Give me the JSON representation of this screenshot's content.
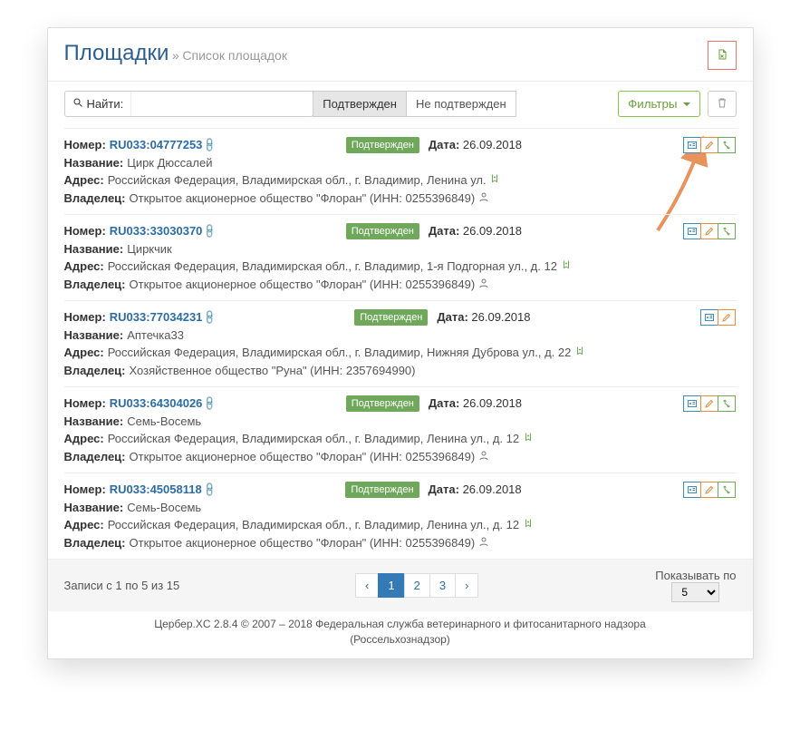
{
  "header": {
    "title": "Площадки",
    "sep": "»",
    "subtitle": "Список площадок"
  },
  "toolbar": {
    "find_label": "Найти:",
    "search_value": "",
    "search_placeholder": "",
    "tab_confirmed": "Подтвержден",
    "tab_unconfirmed": "Не подтвержден",
    "filters_label": "Фильтры"
  },
  "labels": {
    "number": "Номер:",
    "name": "Название:",
    "address": "Адрес:",
    "owner": "Владелец:",
    "date": "Дата:",
    "inn_prefix": "(ИНН:",
    "inn_suffix": ")"
  },
  "badge_confirmed": "Подтвержден",
  "items": [
    {
      "id": "RU033:04777253",
      "date": "26.09.2018",
      "name": "Цирк Дюссалей",
      "address": "Российская Федерация, Владимирская обл., г. Владимир, Ленина ул.",
      "owner": "Открытое акционерное общество \"Флоран\"",
      "inn": "0255396849",
      "show_user_icon": true,
      "actions": [
        "card",
        "edit",
        "branch"
      ]
    },
    {
      "id": "RU033:33030370",
      "date": "26.09.2018",
      "name": "Циркчик",
      "address": "Российская Федерация, Владимирская обл., г. Владимир, 1-я Подгорная ул., д. 12",
      "owner": "Открытое акционерное общество \"Флоран\"",
      "inn": "0255396849",
      "show_user_icon": true,
      "actions": [
        "card",
        "edit",
        "branch"
      ]
    },
    {
      "id": "RU033:77034231",
      "date": "26.09.2018",
      "name": "Аптечка33",
      "address": "Российская Федерация, Владимирская обл., г. Владимир, Нижняя Дуброва ул., д. 22",
      "owner": "Хозяйственное общество \"Руна\"",
      "inn": "2357694990",
      "show_user_icon": false,
      "actions": [
        "card",
        "edit"
      ]
    },
    {
      "id": "RU033:64304026",
      "date": "26.09.2018",
      "name": "Семь-Восемь",
      "address": "Российская Федерация, Владимирская обл., г. Владимир, Ленина ул., д. 12",
      "owner": "Открытое акционерное общество \"Флоран\"",
      "inn": "0255396849",
      "show_user_icon": true,
      "actions": [
        "card",
        "edit",
        "branch"
      ]
    },
    {
      "id": "RU033:45058118",
      "date": "26.09.2018",
      "name": "Семь-Восемь",
      "address": "Российская Федерация, Владимирская обл., г. Владимир, Ленина ул., д. 12",
      "owner": "Открытое акционерное общество \"Флоран\"",
      "inn": "0255396849",
      "show_user_icon": true,
      "actions": [
        "card",
        "edit",
        "branch"
      ]
    }
  ],
  "footer": {
    "records_text": "Записи с 1 по 5 из 15",
    "pages": [
      "1",
      "2",
      "3"
    ],
    "active_page": "1",
    "show_label": "Показывать по",
    "page_size": "5"
  },
  "copyright": {
    "line1": "Цербер.XC 2.8.4 © 2007 – 2018 Федеральная служба ветеринарного и фитосанитарного надзора",
    "line2": "(Россельхознадзор)"
  }
}
